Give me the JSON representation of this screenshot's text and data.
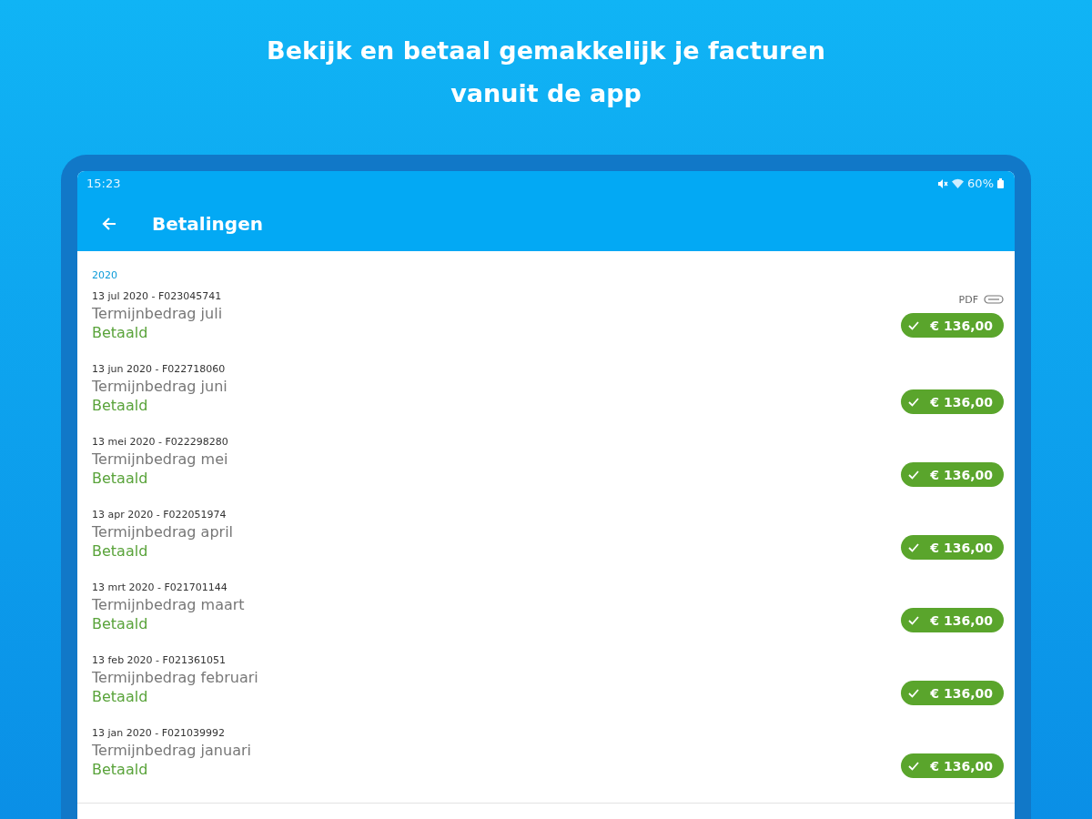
{
  "headline": "Bekijk en betaal gemakkelijk je facturen vanuit de app",
  "status_bar": {
    "time": "15:23",
    "battery": "60%"
  },
  "app_bar": {
    "title": "Betalingen"
  },
  "year": "2020",
  "payments": [
    {
      "date": "13 jul 2020 - F023045741",
      "title": "Termijnbedrag juli",
      "status": "Betaald",
      "amount": "€ 136,00",
      "pdf": "PDF"
    },
    {
      "date": "13 jun 2020 - F022718060",
      "title": "Termijnbedrag juni",
      "status": "Betaald",
      "amount": "€ 136,00"
    },
    {
      "date": "13 mei 2020 - F022298280",
      "title": "Termijnbedrag mei",
      "status": "Betaald",
      "amount": "€ 136,00"
    },
    {
      "date": "13 apr 2020 - F022051974",
      "title": "Termijnbedrag april",
      "status": "Betaald",
      "amount": "€ 136,00"
    },
    {
      "date": "13 mrt 2020 - F021701144",
      "title": "Termijnbedrag maart",
      "status": "Betaald",
      "amount": "€ 136,00"
    },
    {
      "date": "13 feb 2020 - F021361051",
      "title": "Termijnbedrag februari",
      "status": "Betaald",
      "amount": "€ 136,00"
    },
    {
      "date": "13 jan 2020 - F021039992",
      "title": "Termijnbedrag januari",
      "status": "Betaald",
      "amount": "€ 136,00"
    }
  ]
}
